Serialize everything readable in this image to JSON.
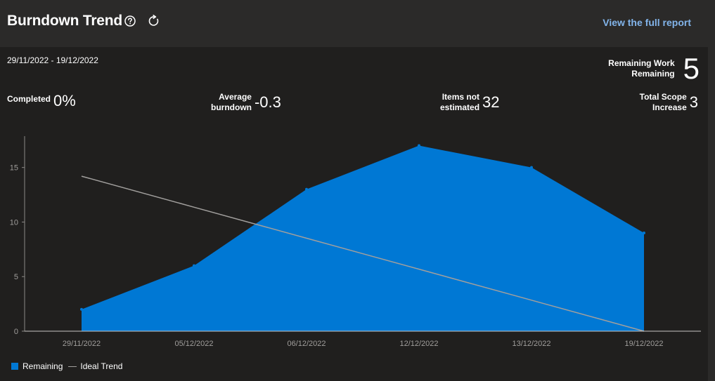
{
  "header": {
    "title": "Burndown Trend",
    "help_icon": "question-circle-icon",
    "refresh_icon": "refresh-icon",
    "full_report_label": "View the full report"
  },
  "summary": {
    "date_range": "29/11/2022 - 19/12/2022",
    "remaining_work": {
      "label": "Remaining Work\nRemaining",
      "value": "5"
    },
    "completed": {
      "label": "Completed",
      "value": "0%"
    },
    "average_burndown": {
      "label": "Average\nburndown",
      "value": "-0.3"
    },
    "items_not_estimated": {
      "label": "Items not\nestimated",
      "value": "32"
    },
    "total_scope_increase": {
      "label": "Total Scope\nIncrease",
      "value": "3"
    }
  },
  "colors": {
    "remaining": "#0078d4",
    "ideal_trend": "#a19f9d",
    "link": "#82b4ea",
    "panel_bg": "#201f1e",
    "header_bg": "#2b2a29"
  },
  "chart_data": {
    "type": "area",
    "categories": [
      "29/11/2022",
      "05/12/2022",
      "06/12/2022",
      "12/12/2022",
      "13/12/2022",
      "19/12/2022"
    ],
    "series": [
      {
        "name": "Remaining",
        "type": "area",
        "values": [
          2,
          6,
          13,
          17,
          15,
          9
        ]
      },
      {
        "name": "Ideal Trend",
        "type": "line",
        "values": [
          14.2,
          11.36,
          8.52,
          5.68,
          2.84,
          0
        ]
      }
    ],
    "y_ticks": [
      0,
      5,
      10,
      15
    ],
    "ylim": [
      0,
      18
    ],
    "grid": false,
    "legend_position": "bottom-left"
  }
}
